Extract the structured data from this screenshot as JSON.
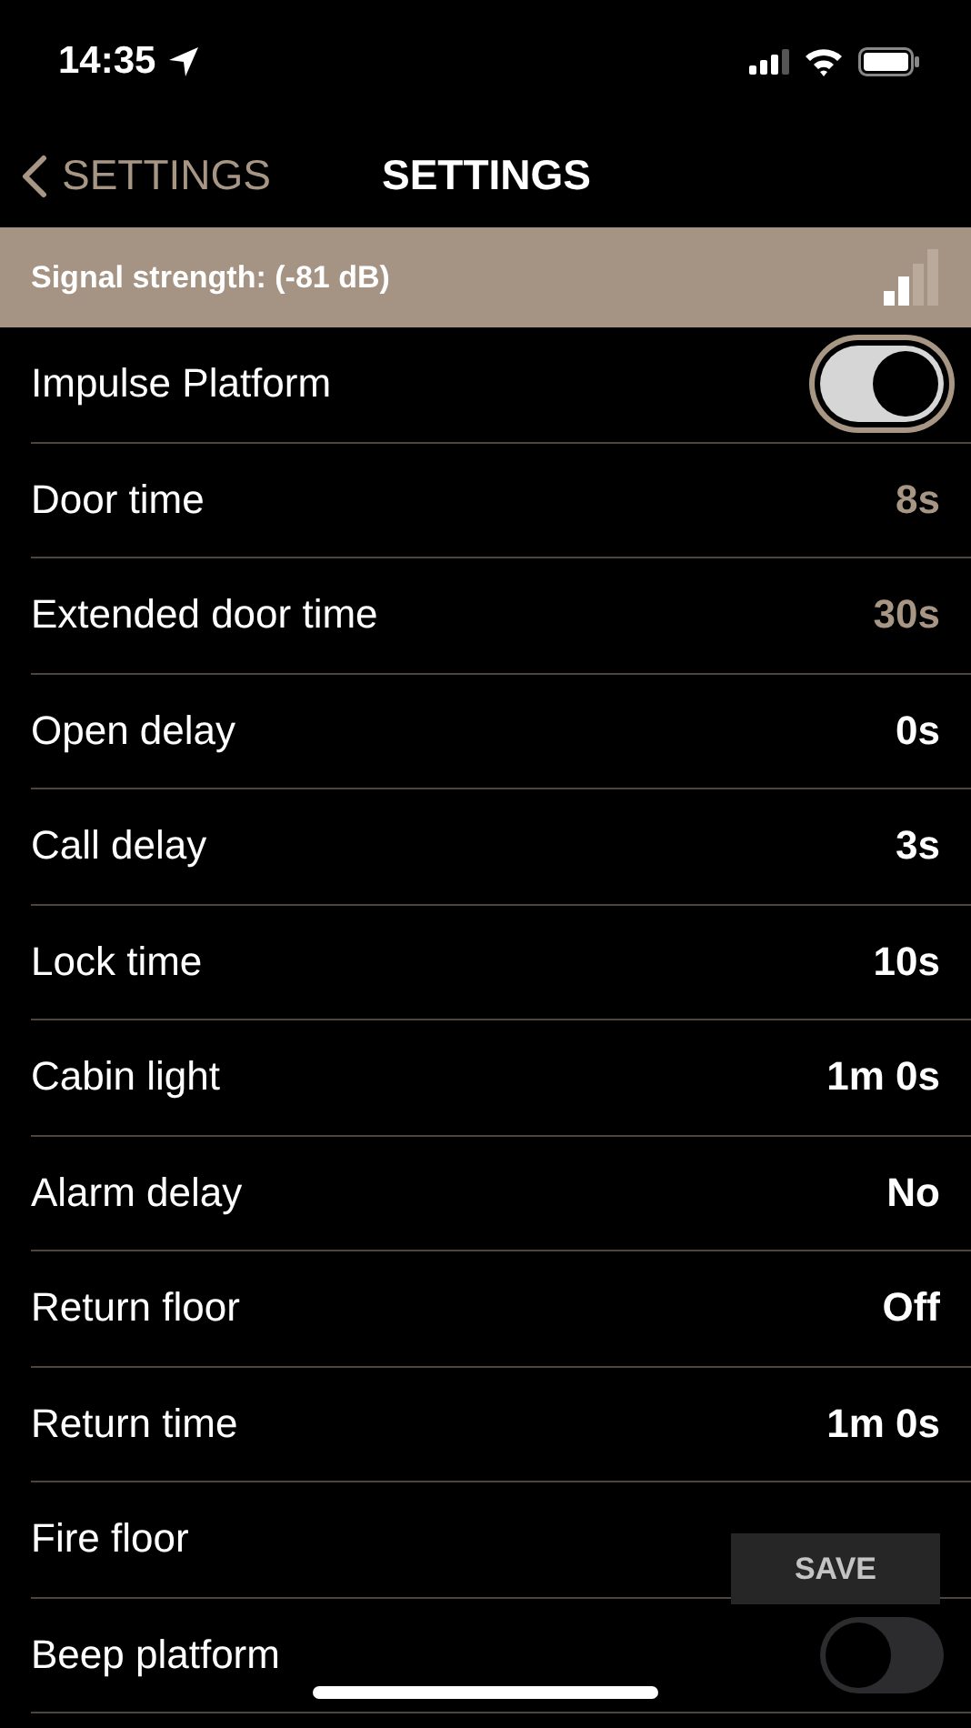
{
  "status_bar": {
    "time": "14:35"
  },
  "nav": {
    "back": "SETTINGS",
    "title": "SETTINGS"
  },
  "signal_banner": {
    "text": "Signal strength: (-81 dB)"
  },
  "rows": [
    {
      "kind": "toggle",
      "label": "Impulse Platform",
      "on": true,
      "focused": true
    },
    {
      "kind": "value",
      "label": "Door time",
      "value": "8s",
      "modified": true
    },
    {
      "kind": "value",
      "label": "Extended door time",
      "value": "30s",
      "modified": true
    },
    {
      "kind": "value",
      "label": "Open delay",
      "value": "0s",
      "modified": false
    },
    {
      "kind": "value",
      "label": "Call delay",
      "value": "3s",
      "modified": false
    },
    {
      "kind": "value",
      "label": "Lock time",
      "value": "10s",
      "modified": false
    },
    {
      "kind": "value",
      "label": "Cabin light",
      "value": "1m 0s",
      "modified": false
    },
    {
      "kind": "value",
      "label": "Alarm delay",
      "value": "No",
      "modified": false
    },
    {
      "kind": "value",
      "label": "Return floor",
      "value": "Off",
      "modified": false
    },
    {
      "kind": "value",
      "label": "Return time",
      "value": "1m 0s",
      "modified": false
    },
    {
      "kind": "label",
      "label": "Fire floor"
    },
    {
      "kind": "toggle",
      "label": "Beep platform",
      "on": false,
      "focused": false
    }
  ],
  "save_button": "SAVE"
}
